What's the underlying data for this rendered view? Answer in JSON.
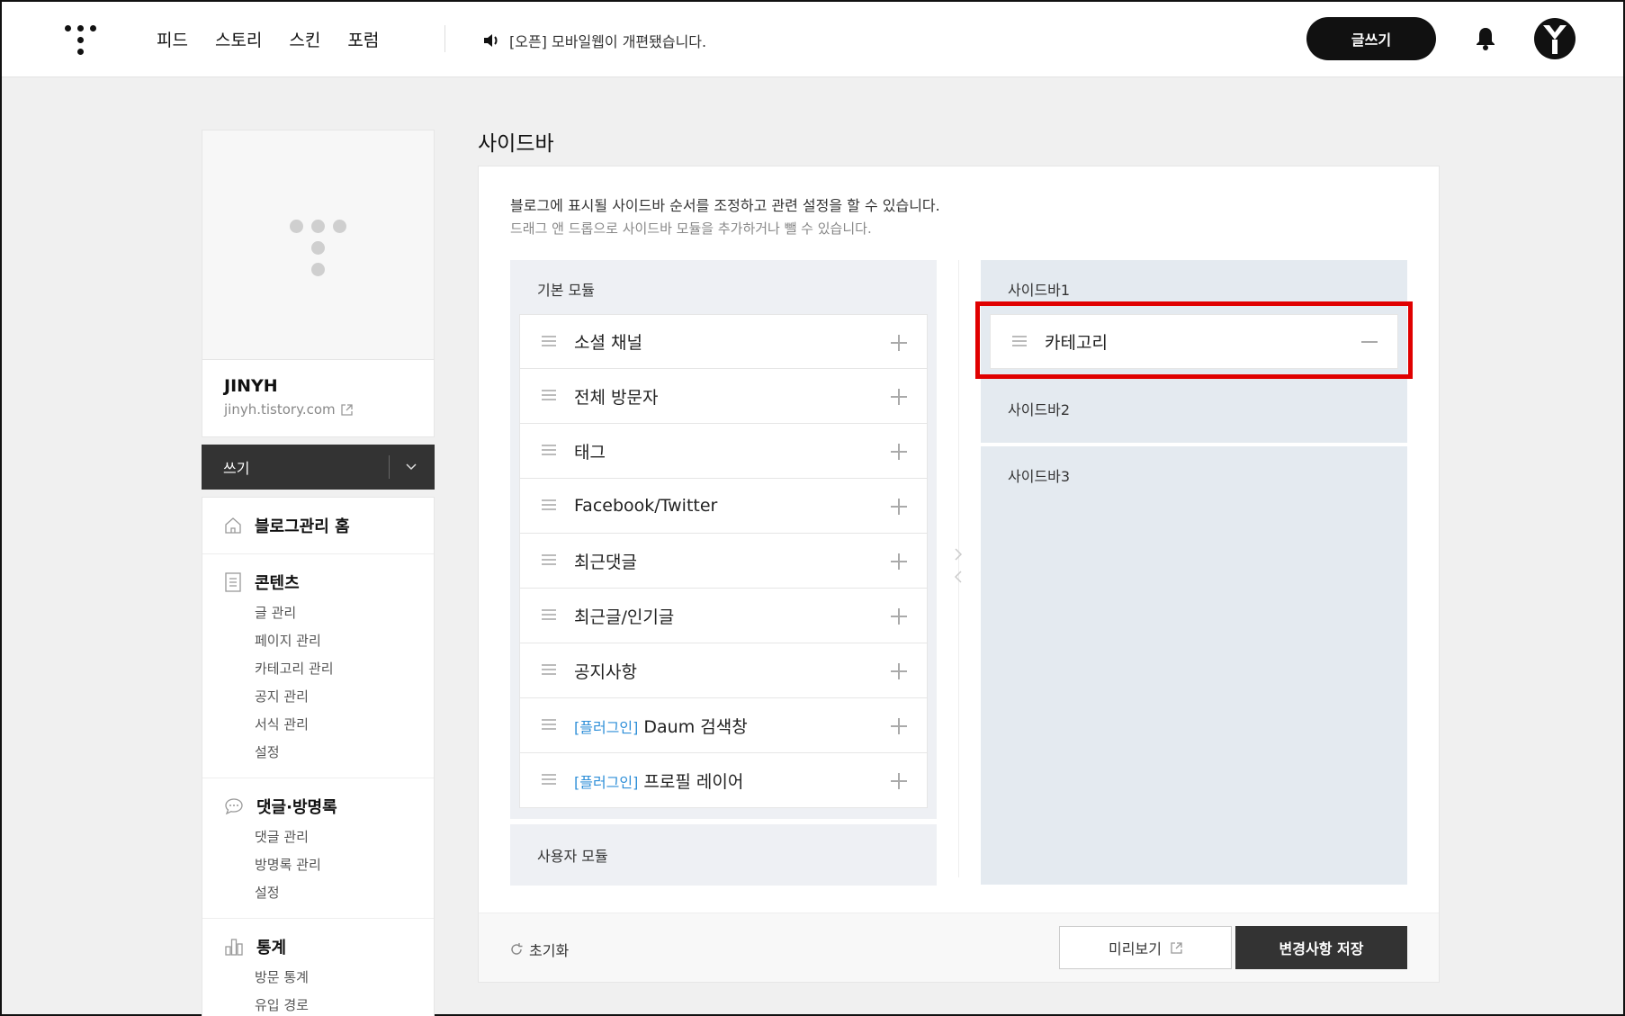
{
  "topbar": {
    "nav": [
      "피드",
      "스토리",
      "스킨",
      "포럼"
    ],
    "notice": "[오픈] 모바일웹이 개편됐습니다.",
    "write_label": "글쓰기"
  },
  "blog": {
    "name": "JINYH",
    "url": "jinyh.tistory.com",
    "write_label": "쓰기"
  },
  "menu": {
    "home": "블로그관리 홈",
    "contents": {
      "title": "콘텐츠",
      "items": [
        "글 관리",
        "페이지 관리",
        "카테고리 관리",
        "공지 관리",
        "서식 관리",
        "설정"
      ]
    },
    "comments": {
      "title": "댓글·방명록",
      "items": [
        "댓글 관리",
        "방명록 관리",
        "설정"
      ]
    },
    "stats": {
      "title": "통계",
      "items": [
        "방문 통계",
        "유입 경로"
      ]
    }
  },
  "main": {
    "title": "사이드바",
    "desc1": "블로그에 표시될 사이드바 순서를 조정하고 관련 설정을 할 수 있습니다.",
    "desc2": "드래그 앤 드롭으로 사이드바 모듈을 추가하거나 뺄 수 있습니다.",
    "basic_title": "기본 모듈",
    "modules": [
      {
        "tag": "",
        "label": "소셜 채널"
      },
      {
        "tag": "",
        "label": "전체 방문자"
      },
      {
        "tag": "",
        "label": "태그"
      },
      {
        "tag": "",
        "label": "Facebook/Twitter"
      },
      {
        "tag": "",
        "label": "최근댓글"
      },
      {
        "tag": "",
        "label": "최근글/인기글"
      },
      {
        "tag": "",
        "label": "공지사항"
      },
      {
        "tag": "[플러그인]",
        "label": "Daum 검색창"
      },
      {
        "tag": "[플러그인]",
        "label": "프로필 레이어"
      }
    ],
    "user_title": "사용자 모듈",
    "sidebar1_title": "사이드바1",
    "sidebar1_items": [
      "카테고리"
    ],
    "sidebar2_title": "사이드바2",
    "sidebar3_title": "사이드바3",
    "reset_label": "초기화",
    "preview_label": "미리보기",
    "save_label": "변경사항 저장"
  }
}
